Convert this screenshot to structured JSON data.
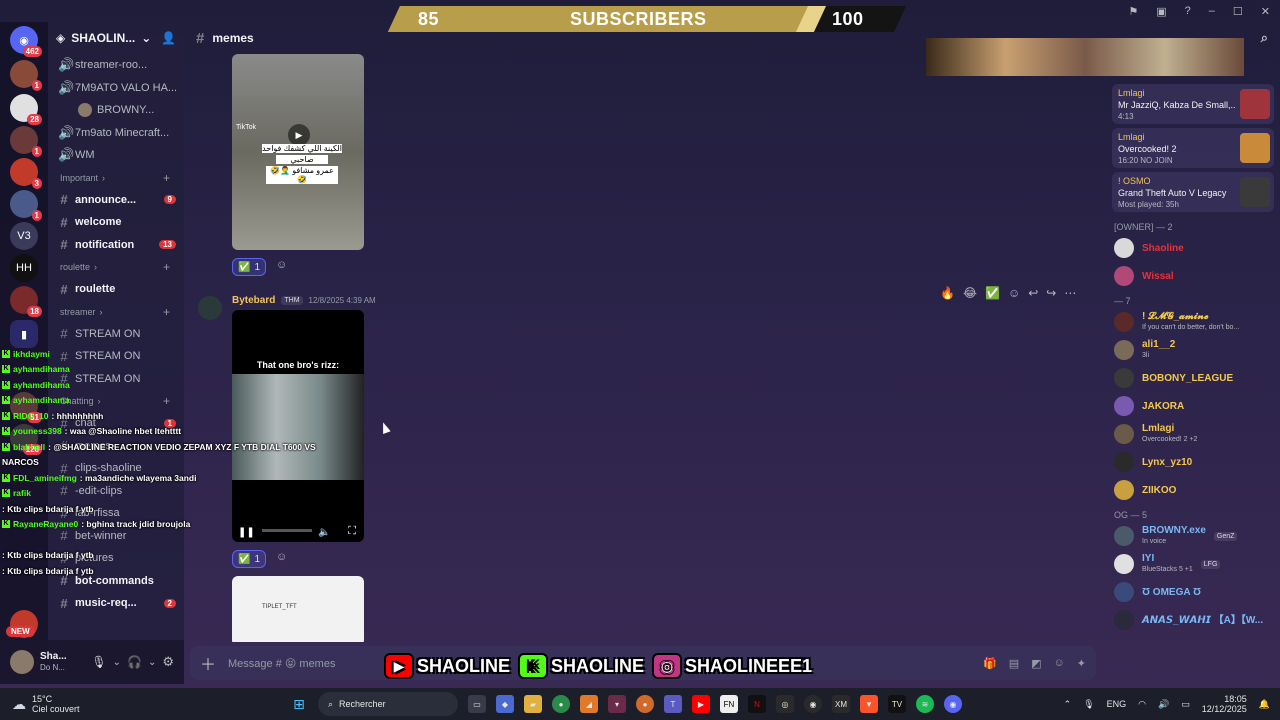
{
  "overlay": {
    "sub_current": "85",
    "sub_label": "SUBSCRIBERS",
    "sub_goal": "100",
    "sub_progress": 0.85
  },
  "rail": {
    "top_badge": "462",
    "servers": [
      {
        "badge": "1"
      },
      {
        "badge": "28"
      },
      {
        "badge": "1"
      },
      {
        "badge": "3"
      },
      {
        "badge": "1"
      },
      {
        "label": "V3"
      },
      {
        "label": "HH"
      },
      {
        "badge": "18"
      },
      {
        "badge": ""
      },
      {
        "badge": "51"
      },
      {
        "badge": "126"
      }
    ],
    "new_label": "NEW"
  },
  "sidebar": {
    "server_name": "SHAOLIN...",
    "items": [
      {
        "type": "voice",
        "label": "streamer-roo..."
      },
      {
        "type": "voice",
        "label": "7M9ATO VALO HA..."
      },
      {
        "type": "user",
        "label": "BROWNY..."
      },
      {
        "type": "voice",
        "label": "7m9ato Minecraft..."
      },
      {
        "type": "voice",
        "label": "WM"
      },
      {
        "type": "cat",
        "label": "Important"
      },
      {
        "type": "text",
        "label": "announce...",
        "count": "9",
        "bold": true
      },
      {
        "type": "text",
        "label": "welcome",
        "bold": true
      },
      {
        "type": "text",
        "label": "notification",
        "count": "13",
        "bold": true
      },
      {
        "type": "cat",
        "label": "roulette"
      },
      {
        "type": "text",
        "label": "roulette",
        "bold": true
      },
      {
        "type": "cat",
        "label": "streamer"
      },
      {
        "type": "text",
        "label": "STREAM ON"
      },
      {
        "type": "text",
        "label": "STREAM ON"
      },
      {
        "type": "text",
        "label": "STREAM ON"
      },
      {
        "type": "cat",
        "label": "Chatting"
      },
      {
        "type": "text",
        "label": "chat",
        "count": "1"
      },
      {
        "type": "text",
        "label": "memes"
      },
      {
        "type": "text",
        "label": "clips-shaoline"
      },
      {
        "type": "text",
        "label": "-edit-clips"
      },
      {
        "type": "text",
        "label": "lab-rfissa"
      },
      {
        "type": "text",
        "label": "bet-winner"
      },
      {
        "type": "text",
        "label": "pictures"
      },
      {
        "type": "text",
        "label": "bot-commands",
        "bold": true
      },
      {
        "type": "text",
        "label": "music-req...",
        "count": "2",
        "bold": true
      }
    ]
  },
  "user_panel": {
    "name": "Sha...",
    "status": "Do N..."
  },
  "header": {
    "channel": "memes"
  },
  "messages": {
    "msg1": {
      "reaction_emoji": "✅",
      "reaction_count": "1",
      "video_lines": [
        "الكينة اللي كشفك فواحد",
        "صاحبي",
        "عمرو مشافو 🤦‍♂️🤣🤣"
      ],
      "tiktok": "TikTok"
    },
    "msg2": {
      "author": "Bytebard",
      "tag": "THM",
      "time": "12/8/2025 4:39 AM",
      "video_caption": "That one bro's rizz:",
      "reaction_emoji": "✅",
      "reaction_count": "1",
      "hover_reactions": [
        "🔥",
        "😂",
        "✅"
      ]
    },
    "msg3": {
      "preview_user": "TIPLET_TFT"
    }
  },
  "composer": {
    "placeholder": "Message # 😝 memes"
  },
  "members": {
    "activities": [
      {
        "name": "Lmlagi",
        "title": "Mr JazziQ, Kabza De Small,...",
        "sub": "4:13",
        "thumb_color": "#a0343c"
      },
      {
        "name": "Lmlagi",
        "title": "Overcooked! 2",
        "sub": "16:20",
        "sub2": "NO JOIN",
        "thumb_color": "#c98a3a"
      },
      {
        "name": "! OSMO",
        "title": "Grand Theft Auto V Legacy",
        "sub": "Most played: 35h",
        "thumb_color": "#3a3a3a"
      }
    ],
    "groups": [
      {
        "label": "[OWNER] — 2",
        "members": [
          {
            "name": "Shaoline",
            "color": "#e8313a",
            "av": "#d9d9d9"
          },
          {
            "name": "Wissal",
            "color": "#e8313a",
            "av": "#b04878"
          }
        ]
      },
      {
        "label": "— 7",
        "members": [
          {
            "name": "! 𝓛𝓜𝓖_𝓪𝓶𝓲𝓷𝓮",
            "color": "#f2c94c",
            "status": "If you can't do better, don't bo...",
            "av": "#5a2a2a"
          },
          {
            "name": "ali1__2",
            "color": "#f2c94c",
            "status": "3li",
            "av": "#7a6a5a"
          },
          {
            "name": "BOBONY_LEAGUE",
            "color": "#f2c94c",
            "av": "#3a3a3a"
          },
          {
            "name": "JAKORA",
            "color": "#f2c94c",
            "av": "#7a5ab0"
          },
          {
            "name": "Lmlagi",
            "color": "#f2c94c",
            "status": "Overcooked! 2 +2",
            "av": "#6a5a4a"
          },
          {
            "name": "Lynx_yz10",
            "color": "#f2c94c",
            "av": "#2a2a2a"
          },
          {
            "name": "ZIIKOO",
            "color": "#f2c94c",
            "av": "#c9a040"
          }
        ]
      },
      {
        "label": "OG — 5",
        "members": [
          {
            "name": "BROWNY.exe",
            "color": "#7ab8f5",
            "status": "In voice",
            "tag": "GenZ",
            "av": "#4a5a6a"
          },
          {
            "name": "IYI",
            "color": "#7ab8f5",
            "status": "BlueStacks 5 +1",
            "tag": "LFG",
            "av": "#e0e0e0"
          },
          {
            "name": "Ʊ OMEGA Ʊ",
            "color": "#7ab8f5",
            "av": "#3a4a7a"
          },
          {
            "name": "𝘼𝙉𝘼𝙎_𝙒𝘼𝙃𝙄 【A】【W...",
            "color": "#7ab8f5",
            "av": "#2a2a3a"
          }
        ]
      }
    ]
  },
  "socials": [
    {
      "icon": "youtube-icon",
      "label": "SHAOLINE",
      "color": "#ff0000"
    },
    {
      "icon": "kick-icon",
      "label": "SHAOLINE",
      "color": "#53fc18"
    },
    {
      "icon": "instagram-icon",
      "label": "SHAOLINEEE1",
      "color": "#c13584"
    }
  ],
  "twitch_chat": [
    {
      "user": "ikhdaymi",
      "msg": ""
    },
    {
      "user": "ayhamdihama",
      "msg": ""
    },
    {
      "user": "ayhamdihama",
      "msg": ""
    },
    {
      "user": "ayhamdihama",
      "msg": ""
    },
    {
      "user": "RIDO_10",
      "msg": ": hhhhhhhhh"
    },
    {
      "user": "youness398",
      "msg": ": waa @Shaoline hbet ltehtttt"
    },
    {
      "user": "blabhall",
      "msg": ": @SHAOLINE REACTION VEDIO ZEPAM XYZ F YTB DIAL T600 VS"
    },
    {
      "user": "",
      "msg": "NARCOS"
    },
    {
      "user": "FDL_amineifmg",
      "msg": ": ma3andiche wlayema 3andi"
    },
    {
      "user": "rafik",
      "msg": ""
    },
    {
      "user": "",
      "msg": ": Ktb clips bdarija f ytb"
    },
    {
      "user": "RayaneRayane0",
      "msg": ": bghina track jdid broujola"
    },
    {
      "user": "",
      "msg": ""
    },
    {
      "user": "",
      "msg": ": Ktb clips bdarija f ytb"
    },
    {
      "user": "",
      "msg": ": Ktb clips bdarija f ytb"
    }
  ],
  "taskbar": {
    "weather_temp": "15°C",
    "weather_desc": "Ciel couvert",
    "search_label": "Rechercher",
    "lang": "ENG",
    "time": "18:05",
    "date": "12/12/2025"
  }
}
